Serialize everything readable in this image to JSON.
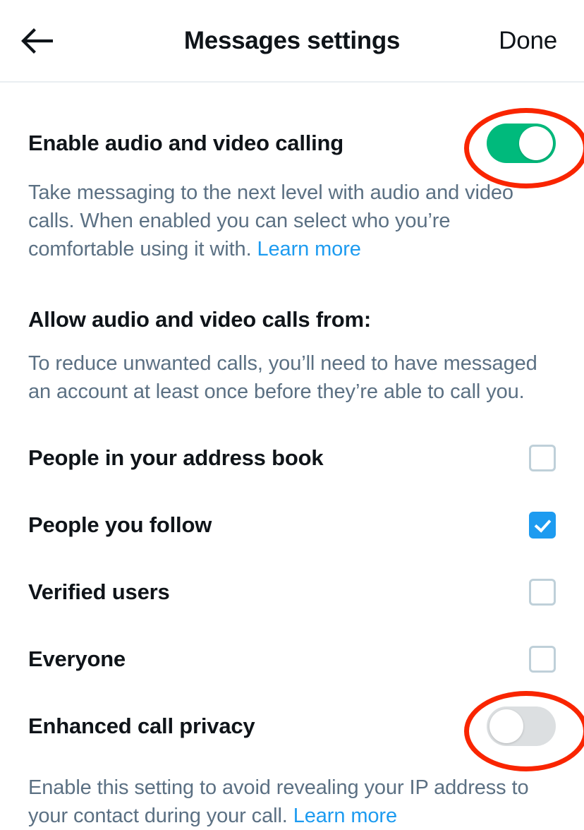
{
  "header": {
    "back_icon": "arrow-left-icon",
    "title": "Messages settings",
    "done_label": "Done"
  },
  "colors": {
    "toggle_on": "#00ba7c",
    "toggle_off": "#dcdfe1",
    "checkbox_checked": "#1d9bf0",
    "checkbox_border": "#bfd0d9",
    "link": "#1d9bf0",
    "annotation": "#f92500",
    "title_text": "#0f1419",
    "body_text": "#5b7083"
  },
  "enable_calling": {
    "title": "Enable audio and video calling",
    "description": "Take messaging to the next level with audio and video calls. When enabled you can select who you’re comfortable using it with. ",
    "learn_more": "Learn more",
    "toggle_state": "on",
    "annotated": true
  },
  "allow_calls": {
    "title": "Allow audio and video calls from:",
    "description": "To reduce unwanted calls, you’ll need to have messaged an account at least once before they’re able to call you.",
    "options": [
      {
        "label": "People in your address book",
        "checked": false
      },
      {
        "label": "People you follow",
        "checked": true
      },
      {
        "label": "Verified users",
        "checked": false
      },
      {
        "label": "Everyone",
        "checked": false
      }
    ]
  },
  "enhanced_privacy": {
    "title": "Enhanced call privacy",
    "description": "Enable this setting to avoid revealing your IP address to your contact during your call. ",
    "learn_more": "Learn more",
    "toggle_state": "off",
    "annotated": true
  }
}
